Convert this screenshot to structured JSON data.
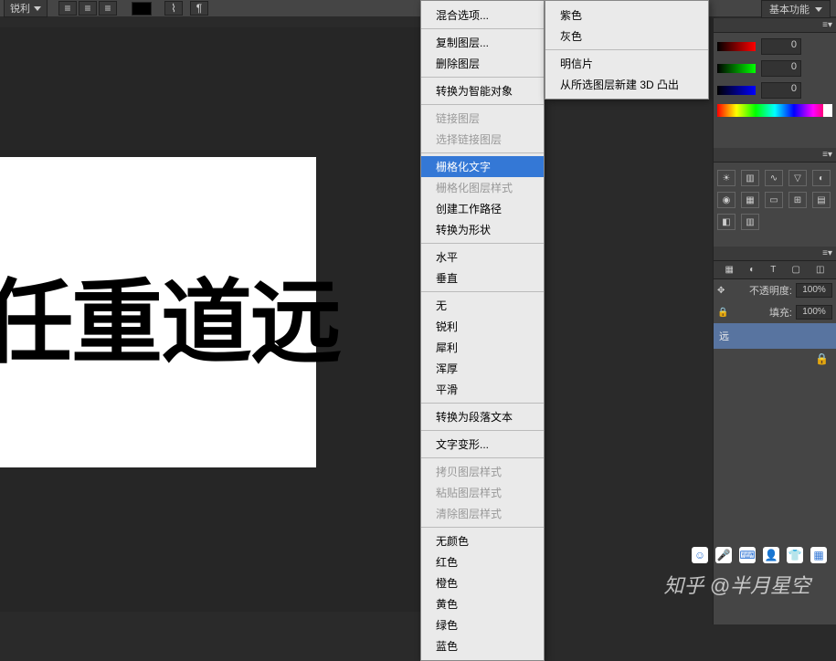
{
  "options_bar": {
    "sharpness_label": "锐利",
    "workspace_label": "基本功能"
  },
  "canvas": {
    "text": "任重道远"
  },
  "context_menu": {
    "items": [
      {
        "label": "混合选项...",
        "kind": "item"
      },
      {
        "kind": "sep"
      },
      {
        "label": "复制图层...",
        "kind": "item"
      },
      {
        "label": "删除图层",
        "kind": "item"
      },
      {
        "kind": "sep"
      },
      {
        "label": "转换为智能对象",
        "kind": "item"
      },
      {
        "kind": "sep"
      },
      {
        "label": "链接图层",
        "kind": "item",
        "disabled": true
      },
      {
        "label": "选择链接图层",
        "kind": "item",
        "disabled": true
      },
      {
        "kind": "sep"
      },
      {
        "label": "栅格化文字",
        "kind": "item",
        "selected": true
      },
      {
        "label": "栅格化图层样式",
        "kind": "item",
        "disabled": true
      },
      {
        "label": "创建工作路径",
        "kind": "item"
      },
      {
        "label": "转换为形状",
        "kind": "item"
      },
      {
        "kind": "sep"
      },
      {
        "label": "水平",
        "kind": "item"
      },
      {
        "label": "垂直",
        "kind": "item"
      },
      {
        "kind": "sep"
      },
      {
        "label": "无",
        "kind": "item"
      },
      {
        "label": "锐利",
        "kind": "item"
      },
      {
        "label": "犀利",
        "kind": "item"
      },
      {
        "label": "浑厚",
        "kind": "item"
      },
      {
        "label": "平滑",
        "kind": "item"
      },
      {
        "kind": "sep"
      },
      {
        "label": "转换为段落文本",
        "kind": "item"
      },
      {
        "kind": "sep"
      },
      {
        "label": "文字变形...",
        "kind": "item"
      },
      {
        "kind": "sep"
      },
      {
        "label": "拷贝图层样式",
        "kind": "item",
        "disabled": true
      },
      {
        "label": "粘贴图层样式",
        "kind": "item",
        "disabled": true
      },
      {
        "label": "清除图层样式",
        "kind": "item",
        "disabled": true
      },
      {
        "kind": "sep"
      },
      {
        "label": "无颜色",
        "kind": "item"
      },
      {
        "label": "红色",
        "kind": "item"
      },
      {
        "label": "橙色",
        "kind": "item"
      },
      {
        "label": "黄色",
        "kind": "item"
      },
      {
        "label": "绿色",
        "kind": "item"
      },
      {
        "label": "蓝色",
        "kind": "item"
      }
    ]
  },
  "sub_menu": {
    "items": [
      {
        "label": "紫色",
        "kind": "item"
      },
      {
        "label": "灰色",
        "kind": "item"
      },
      {
        "kind": "sep"
      },
      {
        "label": "明信片",
        "kind": "item"
      },
      {
        "label": "从所选图层新建 3D 凸出",
        "kind": "item"
      }
    ]
  },
  "color_panel": {
    "r": "0",
    "g": "0",
    "b": "0"
  },
  "layers": {
    "opacity_label": "不透明度:",
    "opacity_value": "100%",
    "fill_label": "填充:",
    "fill_value": "100%",
    "layer_name_suffix": "远"
  },
  "watermark": "知乎 @半月星空"
}
